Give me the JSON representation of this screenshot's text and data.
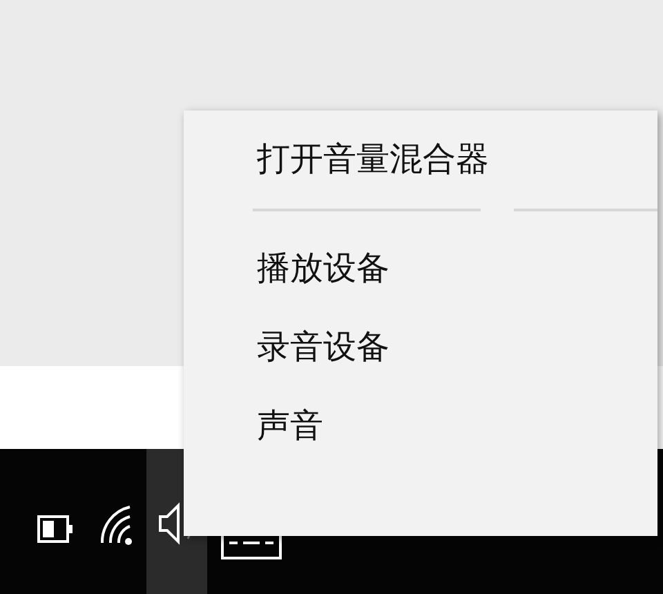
{
  "context_menu": {
    "items": [
      {
        "kind": "item",
        "label": "打开音量混合器"
      },
      {
        "kind": "separator"
      },
      {
        "kind": "item",
        "label": "播放设备"
      },
      {
        "kind": "item",
        "label": "录音设备"
      },
      {
        "kind": "item",
        "label": "声音"
      }
    ]
  },
  "tray_icons": [
    {
      "kind": "battery",
      "selected": false
    },
    {
      "kind": "wifi",
      "selected": false
    },
    {
      "kind": "speaker",
      "selected": true
    },
    {
      "kind": "keyboard",
      "selected": false
    }
  ]
}
